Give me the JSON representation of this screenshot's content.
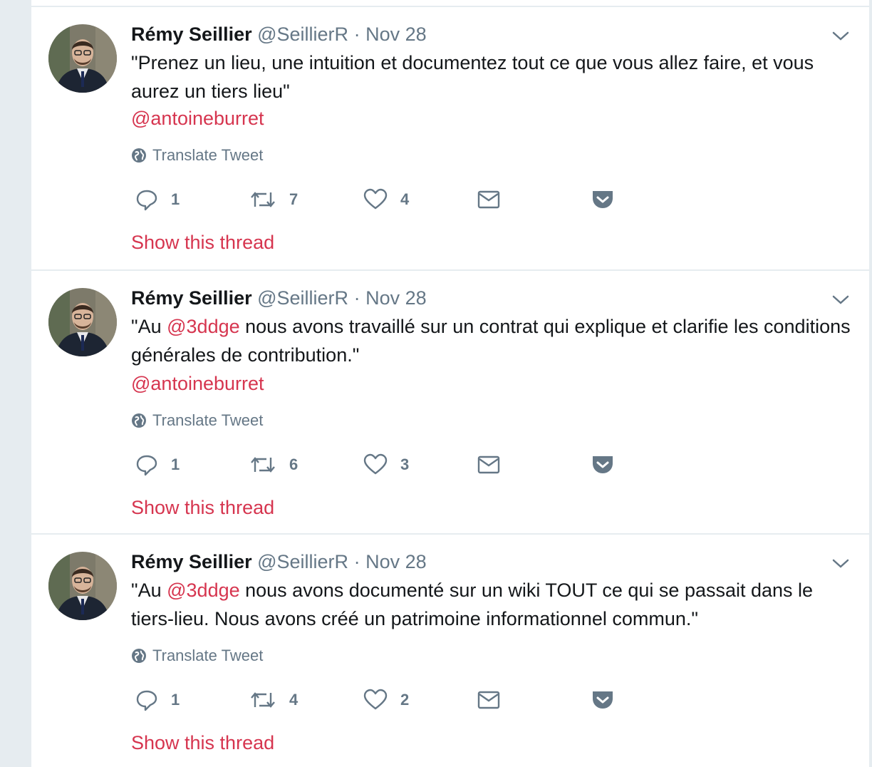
{
  "colors": {
    "accent": "#d6354f",
    "muted": "#657786",
    "text": "#14171a",
    "border": "#e6ecf0"
  },
  "icons": {
    "reply": "reply-icon",
    "retweet": "retweet-icon",
    "like": "heart-icon",
    "dm": "envelope-icon",
    "pocket": "pocket-icon",
    "globe": "globe-icon",
    "caret": "chevron-down-icon"
  },
  "tweets": [
    {
      "fullname": "Rémy Seillier",
      "username": "@SeillierR",
      "sep": "·",
      "time": "Nov 28",
      "text_parts": [
        "\"Prenez un lieu, une intuition et documentez tout ce que vous allez faire, et vous aurez un tiers lieu\""
      ],
      "mention_line": "@antoineburret",
      "translate": "Translate Tweet",
      "replies": "1",
      "retweets": "7",
      "likes": "4",
      "show_thread": "Show this thread"
    },
    {
      "fullname": "Rémy Seillier",
      "username": "@SeillierR",
      "sep": "·",
      "time": "Nov 28",
      "text_parts": [
        "\"Au ",
        "@3ddge",
        " nous avons travaillé sur un contrat qui explique et clarifie les conditions générales de contribution.\""
      ],
      "mention_line": "@antoineburret",
      "translate": "Translate Tweet",
      "replies": "1",
      "retweets": "6",
      "likes": "3",
      "show_thread": "Show this thread"
    },
    {
      "fullname": "Rémy Seillier",
      "username": "@SeillierR",
      "sep": "·",
      "time": "Nov 28",
      "text_parts": [
        "\"Au ",
        "@3ddge",
        " nous avons documenté sur un wiki TOUT ce qui se passait dans le tiers-lieu. Nous avons créé un patrimoine informationnel commun.\""
      ],
      "translate": "Translate Tweet",
      "replies": "1",
      "retweets": "4",
      "likes": "2",
      "show_thread": "Show this thread"
    }
  ]
}
